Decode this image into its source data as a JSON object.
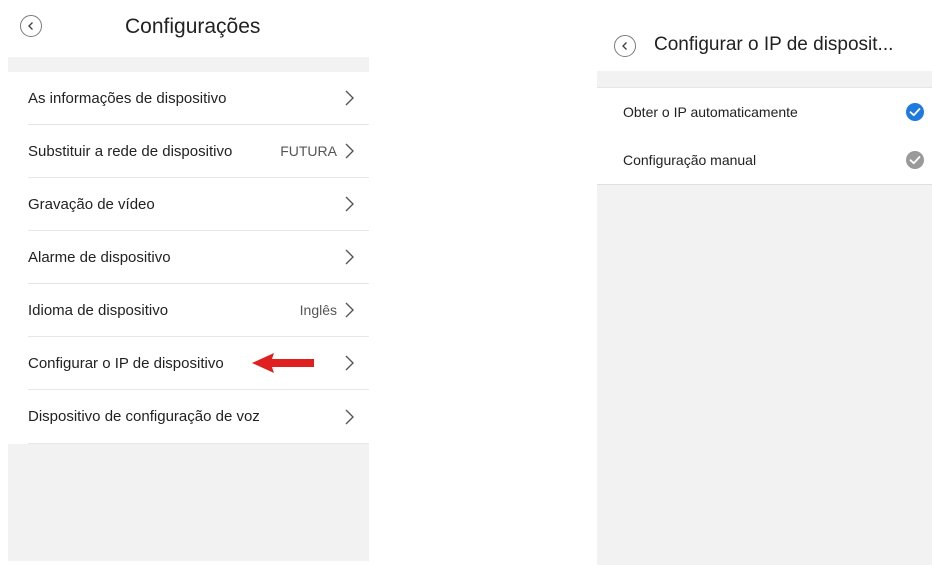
{
  "left": {
    "title": "Configurações",
    "items": [
      {
        "label": "As informações de dispositivo",
        "value": ""
      },
      {
        "label": "Substituir a rede de dispositivo",
        "value": "FUTURA"
      },
      {
        "label": "Gravação de vídeo",
        "value": ""
      },
      {
        "label": "Alarme de dispositivo",
        "value": ""
      },
      {
        "label": "Idioma de dispositivo",
        "value": "Inglês"
      },
      {
        "label": "Configurar o IP de dispositivo",
        "value": ""
      },
      {
        "label": "Dispositivo de configuração de voz",
        "value": ""
      }
    ],
    "annotation_arrow_color": "#e02020"
  },
  "right": {
    "title": "Configurar o IP de disposit...",
    "options": [
      {
        "label": "Obter o IP automaticamente",
        "selected": true
      },
      {
        "label": "Configuração manual",
        "selected": false
      }
    ]
  },
  "colors": {
    "selected_check": "#1f7ae0",
    "unselected_check": "#9a9a9a",
    "band_gray": "#f2f2f2",
    "chevron": "#555555"
  }
}
